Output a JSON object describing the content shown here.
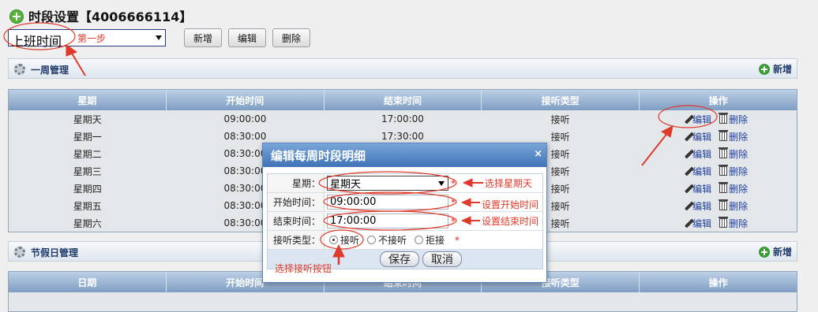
{
  "header": {
    "title": "时段设置【4006666114】"
  },
  "toolbar": {
    "schedule_value": "上班时间",
    "add_label": "新增",
    "edit_label": "编辑",
    "delete_label": "删除"
  },
  "week_section": {
    "label": "一周管理",
    "add_label": "新增"
  },
  "week_table": {
    "headers": [
      "星期",
      "开始时间",
      "结束时间",
      "接听类型",
      "操作"
    ],
    "rows": [
      [
        "星期天",
        "09:00:00",
        "17:00:00",
        "接听"
      ],
      [
        "星期一",
        "08:30:00",
        "17:30:00",
        "接听"
      ],
      [
        "星期二",
        "08:30:00",
        "",
        "接听"
      ],
      [
        "星期三",
        "08:30:00",
        "",
        "接听"
      ],
      [
        "星期四",
        "08:30:00",
        "",
        "接听"
      ],
      [
        "星期五",
        "08:30:00",
        "",
        "接听"
      ],
      [
        "星期六",
        "08:30:00",
        "",
        "接听"
      ]
    ],
    "edit_label": "编辑",
    "delete_label": "删除"
  },
  "holiday_section": {
    "label": "节假日管理",
    "add_label": "新增"
  },
  "holiday_table": {
    "headers": [
      "日期",
      "开始时间",
      "结束时间",
      "接听类型",
      "操作"
    ]
  },
  "dialog": {
    "title": "编辑每周时段明细",
    "close": "×",
    "weekday_label": "星期：",
    "weekday_value": "星期天",
    "start_label": "开始时间：",
    "start_value": "09:00:00",
    "end_label": "结束时间：",
    "end_value": "17:00:00",
    "type_label": "接听类型：",
    "options": [
      "接听",
      "不接听",
      "拒接"
    ],
    "selected_option": "接听",
    "required_mark": "*",
    "save_label": "保存",
    "cancel_label": "取消"
  },
  "annotations": {
    "step1": "第一步",
    "select_weekday": "选择星期天",
    "set_start": "设置开始时间",
    "set_end": "设置结束时间",
    "select_answer": "选择接听按钮"
  },
  "colors": {
    "annotation": "#e03a2a",
    "accent": "#3f73b6"
  }
}
